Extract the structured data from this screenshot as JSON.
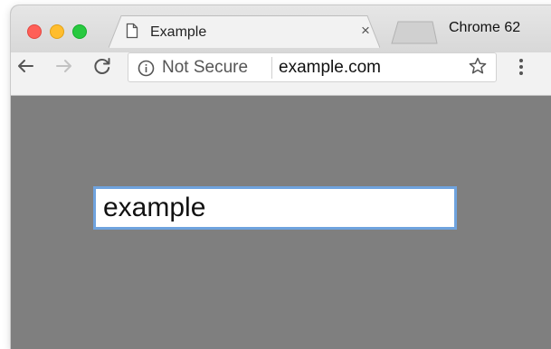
{
  "window": {
    "app_name": "Chrome 62"
  },
  "tab": {
    "title": "Example",
    "close_glyph": "×",
    "icon": "document-icon"
  },
  "toolbar": {
    "back_icon": "back-arrow-icon",
    "forward_icon": "forward-arrow-icon",
    "reload_icon": "reload-icon",
    "security_label": "Not Secure",
    "url": "example.com",
    "bookmark_icon": "star-icon",
    "menu_icon": "kebab-menu-icon"
  },
  "page": {
    "input_value": "example"
  },
  "colors": {
    "page_background": "#7f7f7f",
    "input_focus_border": "#6fa3de",
    "close_button": "#ff5f57",
    "minimize_button": "#ffbd2e",
    "zoom_button": "#28c940"
  }
}
